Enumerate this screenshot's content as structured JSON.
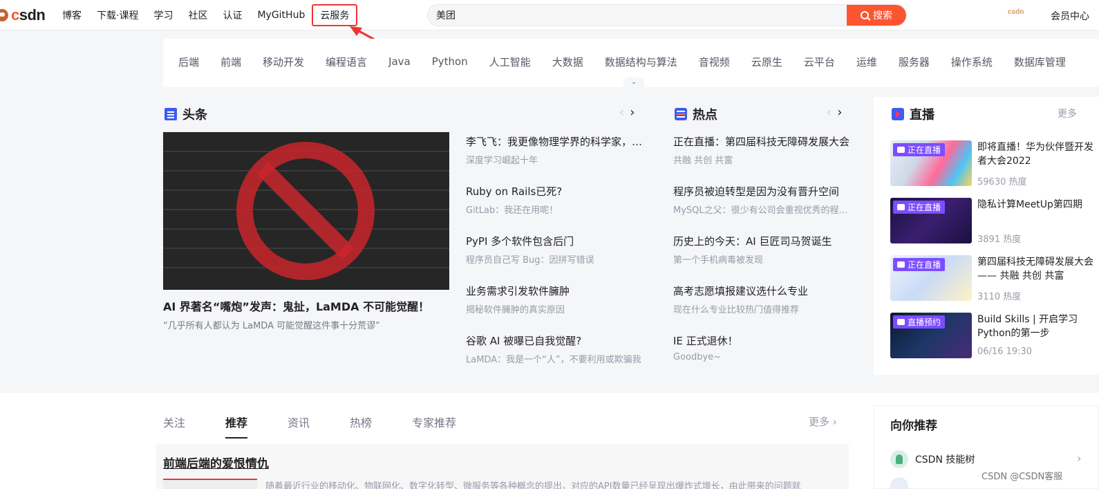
{
  "brand": {
    "logo_prefix": "c",
    "logo_rest": "sdn"
  },
  "nav": {
    "items": [
      "博客",
      "下载·课程",
      "学习",
      "社区",
      "认证",
      "MyGitHub"
    ],
    "highlighted": "云服务"
  },
  "search": {
    "value": "美团",
    "button_label": "搜索"
  },
  "vip": {
    "logo_text": "csdn",
    "link": "会员中心"
  },
  "categories": [
    "后端",
    "前端",
    "移动开发",
    "编程语言",
    "Java",
    "Python",
    "人工智能",
    "大数据",
    "数据结构与算法",
    "音视频",
    "云原生",
    "云平台",
    "运维",
    "服务器",
    "操作系统",
    "数据库管理"
  ],
  "headline": {
    "title": "头条",
    "hero_title": "AI 界著名“嘴炮”发声：鬼扯，LaMDA 不可能觉醒！",
    "hero_sub": "“几乎所有人都认为 LaMDA 可能觉醒这件事十分荒谬”",
    "items": [
      {
        "title": "李飞飞：我更像物理学界的科学家，而不是",
        "sub": "深度学习崛起十年"
      },
      {
        "title": "Ruby on Rails已死?",
        "sub": "GitLab：我还在用呢！"
      },
      {
        "title": "PyPI 多个软件包含后门",
        "sub": "程序员自己写 Bug：因拼写错误"
      },
      {
        "title": "业务需求引发软件臃肿",
        "sub": "揭秘软件臃肿的真实原因"
      },
      {
        "title": "谷歌 AI 被曝已自我觉醒?",
        "sub": "LaMDA：我是一个“人”，不要利用或欺骗我"
      }
    ]
  },
  "hot": {
    "title": "热点",
    "items": [
      {
        "title": "正在直播：第四届科技无障碍发展大会",
        "sub": "共融 共创 共富"
      },
      {
        "title": "程序员被迫转型是因为没有晋升空间",
        "sub": "MySQL之父：很少有公司会重视优秀的程序员"
      },
      {
        "title": "历史上的今天：AI 巨匠司马贺诞生",
        "sub": "第一个手机病毒被发现"
      },
      {
        "title": "高考志愿填报建议选什么专业",
        "sub": "现在什么专业比较热门值得推荐"
      },
      {
        "title": "IE 正式退休！",
        "sub": "Goodbye~"
      }
    ]
  },
  "live": {
    "title": "直播",
    "more": "更多",
    "items": [
      {
        "badge": "正在直播",
        "title": "即将直播！华为伙伴暨开发者大会2022",
        "meta": "59630 热度"
      },
      {
        "badge": "正在直播",
        "title": "隐私计算MeetUp第四期",
        "meta": "3891 热度"
      },
      {
        "badge": "正在直播",
        "title": "第四届科技无障碍发展大会 —— 共融 共创 共富",
        "meta": "3110 热度"
      },
      {
        "badge": "直播预约",
        "title": "Build Skills | 开启学习Python的第一步",
        "meta": "06/16 19:30"
      }
    ]
  },
  "feed": {
    "tabs": [
      "关注",
      "推荐",
      "资讯",
      "热榜",
      "专家推荐"
    ],
    "active_tab": 1,
    "more": "更多",
    "title": "前端后端的爱恨情仇",
    "desc": "随着最近行业的移动化、物联网化、数字化转型、微服务等各种概念的提出，对应的API数量已经呈现出爆炸式增长，由此带来的问题就"
  },
  "recommend": {
    "title": "向你推荐",
    "item": "CSDN 技能树"
  },
  "watermark": "CSDN @CSDN客服",
  "colors": {
    "accent": "#fc5531",
    "live_badge": "#7c4dff",
    "highlight_box": "#ee3333"
  }
}
